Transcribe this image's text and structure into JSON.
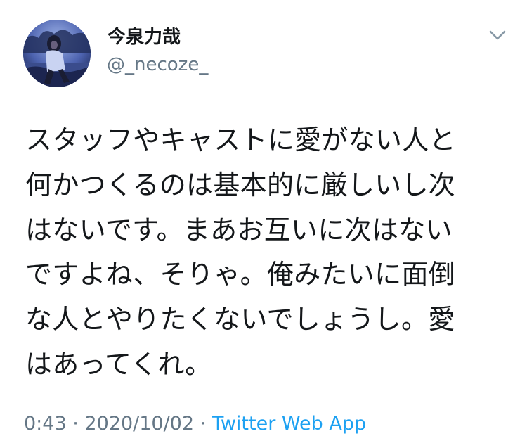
{
  "tweet": {
    "author": {
      "display_name": "今泉力哉",
      "handle": "@_necoze_"
    },
    "text_lines": [
      "スタッフやキャストに愛がない人と",
      "何かつくるのは基本的に厳しいし次",
      "はないです。まあお互いに次はない",
      "ですよね、そりゃ。俺みたいに面倒",
      "な人とやりたくないでしょうし。愛",
      "はあってくれ。"
    ],
    "time": "0:43",
    "separator": "·",
    "date": "2020/10/02",
    "source": "Twitter Web App",
    "menu_icon": "chevron-down-icon",
    "colors": {
      "link": "#1da1f2",
      "secondary_text": "#657786",
      "primary_text": "#14171a"
    }
  }
}
